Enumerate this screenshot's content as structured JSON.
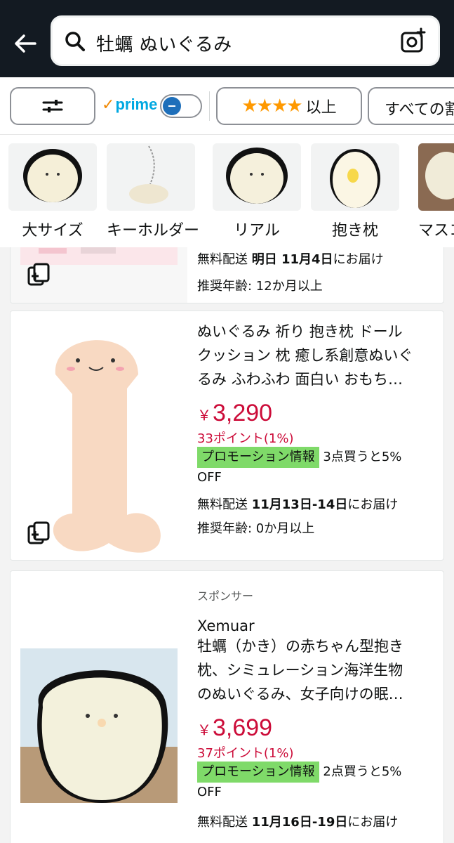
{
  "search": {
    "query": "牡蠣 ぬいぐるみ"
  },
  "filters": {
    "prime_label": "prime",
    "rating_label": "以上",
    "stars": "★★★★",
    "all_label": "すべての割"
  },
  "categories": [
    {
      "label": "大サイズ"
    },
    {
      "label": "キーホルダー"
    },
    {
      "label": "リアル"
    },
    {
      "label": "抱き枕"
    },
    {
      "label": "マスコ"
    }
  ],
  "products": [
    {
      "delivery_prefix": "無料配送",
      "delivery_bold": "明日 11月4日",
      "delivery_suffix": "にお届け",
      "age": "推奨年齢: 12か月以上"
    },
    {
      "title": "ぬいぐるみ 祈り 抱き枕 ドールクッション 枕 癒し系創意ぬいぐるみ ふわふわ 面白い おもち…",
      "title_lines": [
        "ぬいぐるみ 祈り 抱き枕 ドール",
        "クッション 枕 癒し系創意ぬいぐ",
        "るみ ふわふわ 面白い おもち…"
      ],
      "currency": "￥",
      "price": "3,290",
      "points": "33ポイント(1%)",
      "promo_tag": "プロモーション情報",
      "promo_text_1": "3点買うと5%",
      "promo_text_2": "OFF",
      "delivery_prefix": "無料配送",
      "delivery_bold": "11月13日-14日",
      "delivery_suffix": "にお届け",
      "age": "推奨年齢: 0か月以上"
    },
    {
      "sponsor": "スポンサー",
      "brand": "Xemuar",
      "title_lines": [
        "牡蠣（かき）の赤ちゃん型抱き",
        "枕、シミュレーション海洋生物",
        "のぬいぐるみ、女子向けの眠…"
      ],
      "currency": "￥",
      "price": "3,699",
      "points": "37ポイント(1%)",
      "promo_tag": "プロモーション情報",
      "promo_text_1": "2点買うと5%",
      "promo_text_2": "OFF",
      "delivery_prefix": "無料配送",
      "delivery_bold": "11月16日-19日",
      "delivery_suffix": "にお届け"
    }
  ],
  "colors": {
    "header_bg": "#131a22",
    "price_red": "#cc0c39",
    "promo_green": "#7fda69",
    "star_orange": "#ff9900",
    "prime_blue": "#00a8e1"
  }
}
